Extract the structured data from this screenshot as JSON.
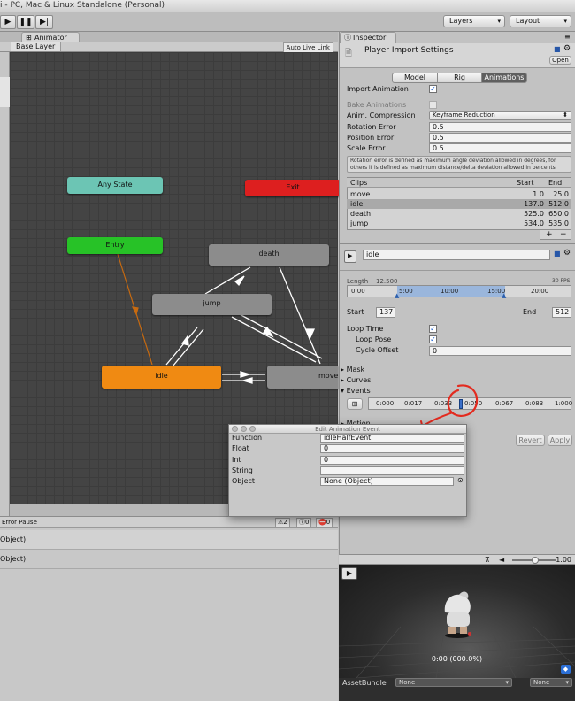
{
  "window": {
    "title": "i - PC, Mac & Linux Standalone (Personal)",
    "layers_label": "Layers",
    "layout_label": "Layout"
  },
  "toolbar": {
    "play_icon": "play-icon",
    "pause_icon": "pause-icon",
    "step_icon": "step-icon"
  },
  "animator": {
    "tab_label": "Animator",
    "layer_label": "Base Layer",
    "auto_live_link_label": "Auto Live Link",
    "states": {
      "any_state": "Any State",
      "exit": "Exit",
      "entry": "Entry",
      "death": "death",
      "jump": "jump",
      "idle": "idle",
      "move": "move"
    }
  },
  "console": {
    "error_pause_label": "Error Pause",
    "warn_count": "2",
    "info_count": "0",
    "error_count": "0",
    "rows": [
      "Object)",
      "Object)"
    ]
  },
  "inspector": {
    "tab_label": "Inspector",
    "title": "Player Import Settings",
    "open_label": "Open",
    "tabs": [
      "Model",
      "Rig",
      "Animations"
    ],
    "import_animation_label": "Import Animation",
    "bake_animations_label": "Bake Animations",
    "anim_compression_label": "Anim. Compression",
    "anim_compression_value": "Keyframe Reduction",
    "rotation_error_label": "Rotation Error",
    "rotation_error_value": "0.5",
    "position_error_label": "Position Error",
    "position_error_value": "0.5",
    "scale_error_label": "Scale Error",
    "scale_error_value": "0.5",
    "help_text": "Rotation error is defined as maximum angle deviation allowed in degrees, for others it is defined as maximum distance/delta deviation allowed in percents",
    "clips": {
      "headers": {
        "name": "Clips",
        "start": "Start",
        "end": "End"
      },
      "rows": [
        {
          "name": "move",
          "start": "1.0",
          "end": "25.0"
        },
        {
          "name": "idle",
          "start": "137.0",
          "end": "512.0"
        },
        {
          "name": "death",
          "start": "525.0",
          "end": "650.0"
        },
        {
          "name": "jump",
          "start": "534.0",
          "end": "535.0"
        }
      ],
      "add_label": "+",
      "remove_label": "−"
    },
    "clip_name": "idle",
    "length_label": "Length",
    "length_value": "12.500",
    "fps_label": "30 FPS",
    "timeline_ticks": [
      "0:00",
      "5:00",
      "10:00",
      "15:00",
      "20:00"
    ],
    "start_label": "Start",
    "start_value": "137",
    "end_label": "End",
    "end_value": "512",
    "loop_time_label": "Loop Time",
    "loop_pose_label": "Loop Pose",
    "cycle_offset_label": "Cycle Offset",
    "cycle_offset_value": "0",
    "mask_label": "Mask",
    "curves_label": "Curves",
    "events_label": "Events",
    "event_ticks": [
      "0:000",
      "0:017",
      "0:033",
      "0:050",
      "0:067",
      "0:083",
      "1:000"
    ],
    "motion_label": "Motion",
    "revert_label": "Revert",
    "apply_label": "Apply"
  },
  "preview": {
    "speed_value": "1.00",
    "time_readout": "0:00 (000.0%)",
    "asset_bundle_label": "AssetBundle",
    "asset_bundle_value": "None",
    "variant_value": "None"
  },
  "edit_event_dialog": {
    "title": "Edit Animation Event",
    "function_label": "Function",
    "function_value": "idleHalfEvent",
    "float_label": "Float",
    "float_value": "0",
    "int_label": "Int",
    "int_value": "0",
    "string_label": "String",
    "string_value": "",
    "object_label": "Object",
    "object_value": "None (Object)"
  },
  "colors": {
    "any_state": "#6cc5b4",
    "exit": "#dd1f1f",
    "entry": "#27c227",
    "idle": "#f08a12",
    "state_gray": "#8c8c8c",
    "annotation": "#e32b1f"
  }
}
